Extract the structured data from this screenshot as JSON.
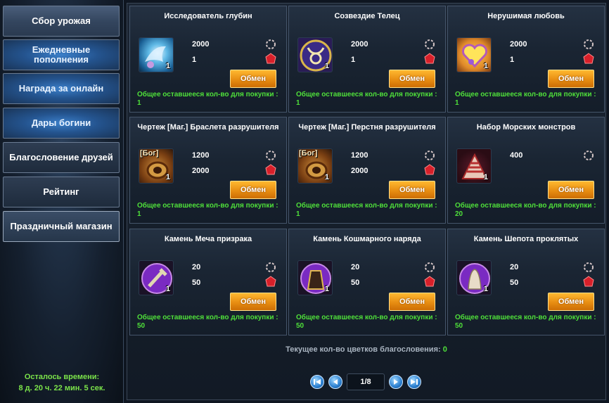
{
  "sidebar": {
    "items": [
      {
        "label": "Сбор урожая"
      },
      {
        "label": "Ежедневные пополнения"
      },
      {
        "label": "Награда за онлайн"
      },
      {
        "label": "Дары богини"
      },
      {
        "label": "Благословение друзей"
      },
      {
        "label": "Рейтинг"
      },
      {
        "label": "Праздничный магазин"
      }
    ],
    "timer_label": "Осталось времени:",
    "timer_value": "8 д. 20 ч. 22 мин. 5 сек."
  },
  "cards": [
    {
      "title": "Исследователь глубин",
      "count": "1",
      "price1": "2000",
      "price2": "1",
      "button": "Обмен",
      "remain": "Общее оставшееся кол-во для покупки : 1",
      "icon": "deep-explorer-icon"
    },
    {
      "title": "Созвездие Телец",
      "count": "1",
      "price1": "2000",
      "price2": "1",
      "button": "Обмен",
      "remain": "Общее оставшееся кол-во для покупки : 1",
      "icon": "taurus-icon"
    },
    {
      "title": "Нерушимая любовь",
      "count": "1",
      "price1": "2000",
      "price2": "1",
      "button": "Обмен",
      "remain": "Общее оставшееся кол-во для покупки : 1",
      "icon": "unbreakable-love-icon"
    },
    {
      "title": "Чертеж [Маг.] Браслета разрушителя",
      "count": "1",
      "price1": "1200",
      "price2": "2000",
      "button": "Обмен",
      "remain": "Общее оставшееся кол-во для покупки : 1",
      "icon": "bracelet-blueprint-icon",
      "badge": "[Бог]"
    },
    {
      "title": "Чертеж [Маг.] Перстня разрушителя",
      "count": "1",
      "price1": "1200",
      "price2": "2000",
      "button": "Обмен",
      "remain": "Общее оставшееся кол-во для покупки : 1",
      "icon": "ring-blueprint-icon",
      "badge": "[Бог]"
    },
    {
      "title": "Набор Морских монстров",
      "count": "1",
      "price1": "400",
      "price2": "",
      "button": "Обмен",
      "remain": "Общее оставшееся кол-во для покупки : 20",
      "icon": "sea-monsters-set-icon"
    },
    {
      "title": "Камень Меча призрака",
      "count": "1",
      "price1": "20",
      "price2": "50",
      "button": "Обмен",
      "remain": "Общее оставшееся кол-во для покупки : 50",
      "icon": "ghost-sword-stone-icon"
    },
    {
      "title": "Камень Кошмарного наряда",
      "count": "1",
      "price1": "20",
      "price2": "50",
      "button": "Обмен",
      "remain": "Общее оставшееся кол-во для покупки : 50",
      "icon": "nightmare-outfit-stone-icon"
    },
    {
      "title": "Камень Шепота проклятых",
      "count": "1",
      "price1": "20",
      "price2": "50",
      "button": "Обмен",
      "remain": "Общее оставшееся кол-во для покупки : 50",
      "icon": "cursed-whisper-stone-icon"
    }
  ],
  "blessing": {
    "label": "Текущее кол-во цветков благословения:",
    "value": "0"
  },
  "pager": {
    "text": "1/8"
  },
  "colors": {
    "accent_green": "#4fe03a",
    "button_orange": "#e58a10",
    "bg": "#121a25"
  }
}
